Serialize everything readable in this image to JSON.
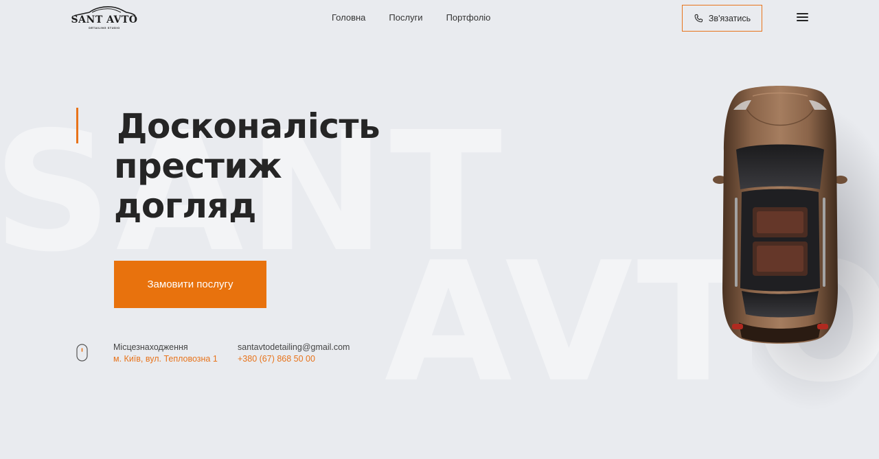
{
  "watermark": {
    "line1": "SANT",
    "line2": "AVTO"
  },
  "header": {
    "logo": {
      "text": "SANT AVTO",
      "subtitle": "DETAILING STUDIO"
    },
    "nav": [
      {
        "label": "Головна"
      },
      {
        "label": "Послуги"
      },
      {
        "label": "Портфоліо"
      }
    ],
    "contact_button": {
      "label": "Зв'язатись",
      "icon": "phone-icon"
    },
    "menu_icon": "hamburger-menu-icon"
  },
  "hero": {
    "title_lines": [
      "Досконалість",
      "престиж",
      "догляд"
    ],
    "cta_label": "Замовити послугу"
  },
  "info": {
    "location_label": "Місцезнаходження",
    "location_value": "м. Київ, вул. Тепловозна 1",
    "email": "santavtodetailing@gmail.com",
    "phone": "+380 (67) 868 50 00",
    "scroll_icon": "mouse-icon"
  },
  "colors": {
    "accent": "#e8731a",
    "background": "#e9ebef",
    "text": "#252525"
  }
}
